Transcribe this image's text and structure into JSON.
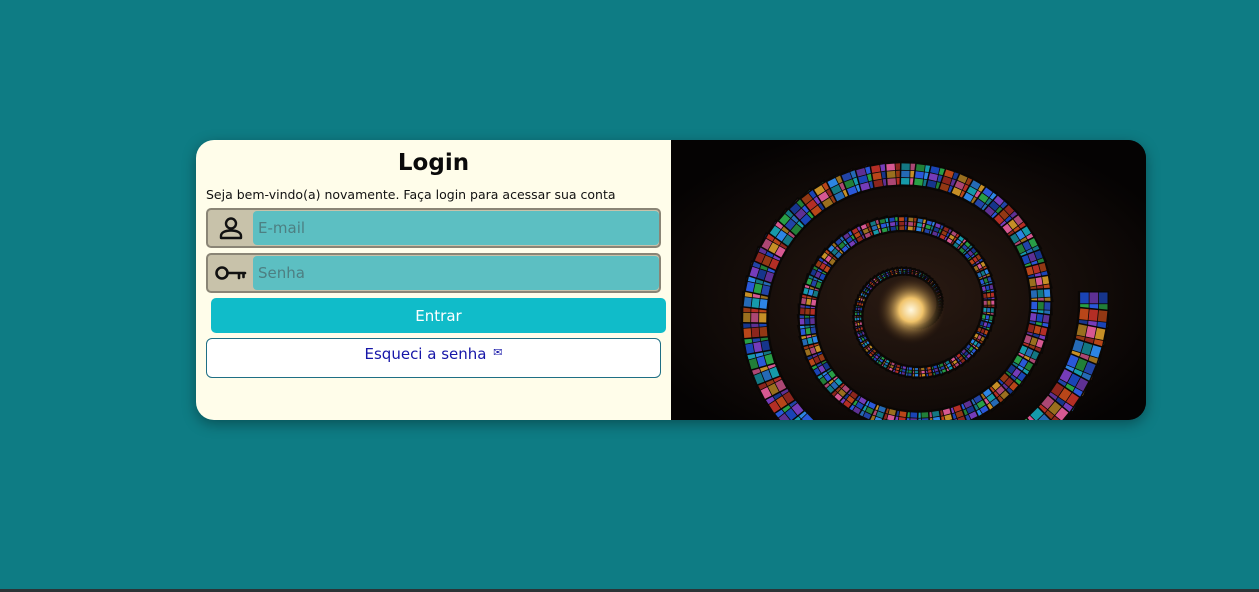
{
  "login": {
    "title": "Login",
    "subtitle": "Seja bem-vindo(a) novamente. Faça login para acessar sua conta",
    "email": {
      "placeholder": "E-mail",
      "value": "",
      "icon": "user-icon"
    },
    "password": {
      "placeholder": "Senha",
      "value": "",
      "icon": "key-icon"
    },
    "submit_label": "Entrar",
    "forgot_label": "Esqueci a senha",
    "forgot_icon": "envelope-icon"
  },
  "image": {
    "description_icon": "stained-glass-spiral-image"
  },
  "colors": {
    "background": "#0e7c84",
    "panel": "#fffdea",
    "input": "#5cbfc2",
    "button": "#10bcc9",
    "link": "#1616a8"
  }
}
